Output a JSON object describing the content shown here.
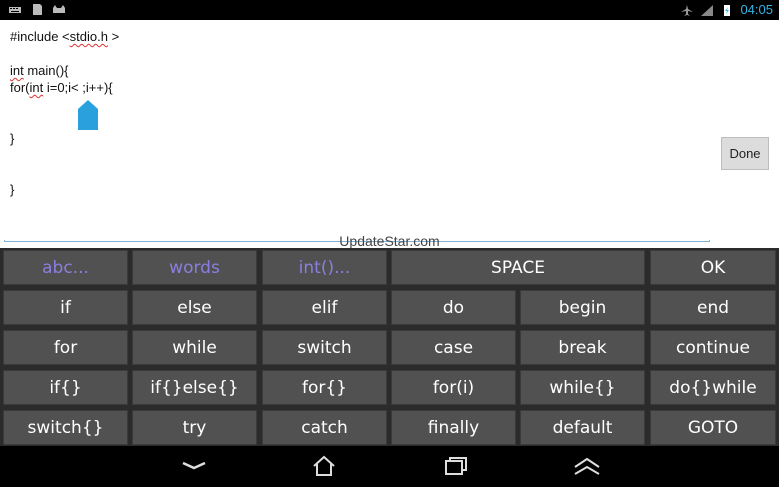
{
  "status_bar": {
    "time": "04:05",
    "left_icons": [
      "keyboard-icon",
      "sd-card-icon",
      "cat-icon"
    ],
    "right_icons": [
      "airplane-mode-icon",
      "signal-icon",
      "battery-charging-icon"
    ],
    "accent_color": "#33b5e5"
  },
  "editor": {
    "lines": [
      {
        "parts": [
          {
            "t": "#include <",
            "sq": false
          },
          {
            "t": "stdio.h",
            "sq": true
          },
          {
            "t": " >",
            "sq": false
          }
        ]
      },
      {
        "parts": []
      },
      {
        "parts": [
          {
            "t": "int",
            "sq": true
          },
          {
            "t": " main(){",
            "sq": false
          }
        ]
      },
      {
        "parts": [
          {
            "t": "for(",
            "sq": false
          },
          {
            "t": "int",
            "sq": true
          },
          {
            "t": " i=0;i< ;i++){",
            "sq": false
          }
        ]
      },
      {
        "parts": []
      },
      {
        "parts": []
      },
      {
        "parts": [
          {
            "t": "}",
            "sq": false
          }
        ]
      },
      {
        "parts": []
      },
      {
        "parts": []
      },
      {
        "parts": [
          {
            "t": "}",
            "sq": false
          }
        ]
      }
    ],
    "done_label": "Done",
    "watermark": "UpdateStar.com"
  },
  "keyboard": {
    "rows": [
      [
        {
          "label": "abc...",
          "purple": true,
          "name": "key-abc"
        },
        {
          "label": "words",
          "purple": true,
          "name": "key-words"
        },
        {
          "label": "int()...",
          "purple": true,
          "name": "key-int-functions"
        },
        {
          "label": "SPACE",
          "purple": false,
          "name": "key-space",
          "wide": true
        },
        {
          "label": "OK",
          "purple": false,
          "name": "key-ok"
        }
      ],
      [
        {
          "label": "if",
          "name": "key-if"
        },
        {
          "label": "else",
          "name": "key-else"
        },
        {
          "label": "elif",
          "name": "key-elif"
        },
        {
          "label": "do",
          "name": "key-do"
        },
        {
          "label": "begin",
          "name": "key-begin"
        },
        {
          "label": "end",
          "name": "key-end"
        }
      ],
      [
        {
          "label": "for",
          "name": "key-for"
        },
        {
          "label": "while",
          "name": "key-while"
        },
        {
          "label": "switch",
          "name": "key-switch"
        },
        {
          "label": "case",
          "name": "key-case"
        },
        {
          "label": "break",
          "name": "key-break"
        },
        {
          "label": "continue",
          "name": "key-continue"
        }
      ],
      [
        {
          "label": "if{}",
          "name": "key-if-block"
        },
        {
          "label": "if{}else{}",
          "name": "key-if-else-block"
        },
        {
          "label": "for{}",
          "name": "key-for-block"
        },
        {
          "label": "for(i)",
          "name": "key-for-i"
        },
        {
          "label": "while{}",
          "name": "key-while-block"
        },
        {
          "label": "do{}while",
          "name": "key-do-while"
        }
      ],
      [
        {
          "label": "switch{}",
          "name": "key-switch-block"
        },
        {
          "label": "try",
          "name": "key-try"
        },
        {
          "label": "catch",
          "name": "key-catch"
        },
        {
          "label": "finally",
          "name": "key-finally"
        },
        {
          "label": "default",
          "name": "key-default"
        },
        {
          "label": "GOTO",
          "name": "key-goto"
        }
      ]
    ],
    "colors": {
      "key_bg": "#515151",
      "purple_text": "#8a7fe0"
    }
  },
  "nav_bar": {
    "buttons": [
      "hide-keyboard-icon",
      "home-icon",
      "recent-apps-icon",
      "menu-up-icon"
    ]
  }
}
